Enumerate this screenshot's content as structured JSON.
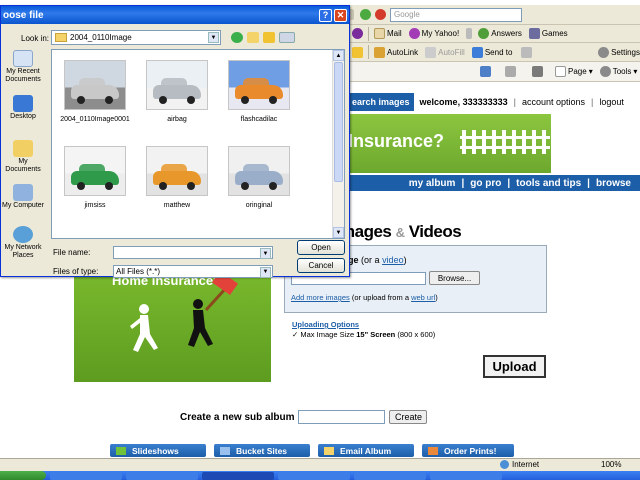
{
  "dialog": {
    "title": "oose file",
    "look_in_label": "Look in:",
    "look_in_value": "2004_0110Image",
    "file_name_label": "File name:",
    "file_name_value": "",
    "files_of_type_label": "Files of type:",
    "files_of_type_value": "All Files (*.*)",
    "open_label": "Open",
    "cancel_label": "Cancel",
    "help_glyph": "?",
    "close_glyph": "✕",
    "places": [
      {
        "label": "My Recent Documents",
        "color": "#d6e3f5"
      },
      {
        "label": "Desktop",
        "color": "#3a78d6"
      },
      {
        "label": "My Documents",
        "color": "#f2cf62"
      },
      {
        "label": "My Computer",
        "color": "#8fb2de"
      },
      {
        "label": "My Network Places",
        "color": "#5aa0d8"
      }
    ],
    "thumbnails": [
      {
        "label": "2004_0110Image0001",
        "sky": "#cfd8e0",
        "car": "#c8c8c8",
        "ground": "#8d8d8d"
      },
      {
        "label": "airbag",
        "sky": "#eaf0f4",
        "car": "#b7bcc2",
        "ground": "#f2f2f2"
      },
      {
        "label": "flashcadilac",
        "sky": "#6f9ee5",
        "car": "#e98a2c",
        "ground": "#e8e8f2"
      },
      {
        "label": "jimsiss",
        "sky": "#f4f4f4",
        "car": "#2e9a4a",
        "ground": "#ededed"
      },
      {
        "label": "matthew",
        "sky": "#f2f2f2",
        "car": "#e8982a",
        "ground": "#e2e2e2"
      },
      {
        "label": "oringinal",
        "sky": "#f0f0f0",
        "car": "#9aaec9",
        "ground": "#e2e2e2"
      }
    ]
  },
  "browser": {
    "search_placeholder": "Google",
    "toolbar_row1": [
      "Mail",
      "My Yahoo!",
      "Answers",
      "Games"
    ],
    "toolbar_row2": [
      "AutoLink",
      "AutoFill",
      "Send to",
      "Settings"
    ],
    "toolbar_row3": [
      "Page",
      "Tools"
    ],
    "status_zone": "Internet",
    "zoom": "100%"
  },
  "site": {
    "search_button": "earch images",
    "welcome": "welcome, 333333333",
    "account_options": "account options",
    "logout": "logout",
    "banner_text": "Insurance?",
    "nav": [
      "my album",
      "go pro",
      "tools and tips",
      "browse"
    ],
    "upload_title_part1": "mages",
    "upload_title_amp": "&",
    "upload_title_part2": "Videos",
    "upload_prefix": "age",
    "upload_or": "(or a",
    "upload_video_link": "video",
    "upload_suffix": ")",
    "browse_label": "Browse...",
    "add_more_link": "Add more images",
    "upload_from_text": "(or upload from a",
    "web_url_link": "web url",
    "close_paren": ")",
    "uploading_options": "Uploading Options",
    "max_image_size_label": "Max Image Size",
    "max_image_size_value": "15\" Screen",
    "max_image_size_dims": "(800 x 600)",
    "upload_button": "Upload",
    "ad_text": "Home Insurance?",
    "create_sub_album_label": "Create a new sub album",
    "create_button": "Create",
    "feature_buttons": [
      "Slideshows",
      "Bucket Sites",
      "Email Album",
      "Order Prints!"
    ]
  },
  "colors": {
    "brand_blue": "#1c5ea7",
    "ad_green": "#7bbb2e",
    "xp_title_blue": "#0a5bd9"
  }
}
